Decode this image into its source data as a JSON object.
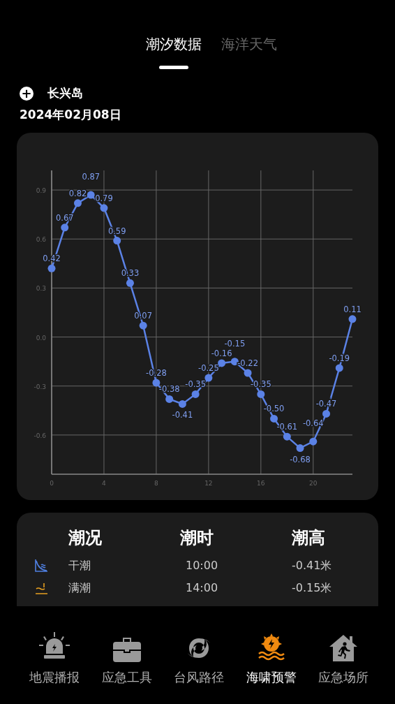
{
  "tabs": [
    {
      "label": "潮汐数据",
      "selected": true
    },
    {
      "label": "海洋天气",
      "selected": false
    }
  ],
  "location": {
    "add_icon": "+",
    "name": "长兴岛",
    "date": "2024年02月08日"
  },
  "chart": {
    "chart_data": {
      "type": "line",
      "x": [
        0,
        1,
        2,
        3,
        4,
        5,
        6,
        7,
        8,
        9,
        10,
        11,
        12,
        13,
        14,
        15,
        16,
        17,
        18,
        19,
        20,
        21,
        22,
        23
      ],
      "series": [
        {
          "color": "#5b82e6",
          "marker": "circle",
          "values": [
            0.42,
            0.67,
            0.82,
            0.87,
            0.79,
            0.59,
            0.33,
            0.07,
            -0.28,
            -0.38,
            -0.41,
            -0.35,
            -0.25,
            -0.16,
            -0.15,
            -0.22,
            -0.35,
            -0.5,
            -0.61,
            -0.68,
            -0.64,
            -0.47,
            -0.19,
            0.11
          ]
        }
      ],
      "xlim": [
        0,
        23
      ],
      "ylim": [
        -0.84,
        1.02
      ],
      "xticks": [
        0,
        4,
        8,
        12,
        16,
        20
      ],
      "yticks": [
        {
          "value": -0.6,
          "label": "-0.6"
        },
        {
          "value": -0.3,
          "label": "-0.3"
        },
        {
          "value": 0,
          "label": "0.0"
        },
        {
          "value": 0.3,
          "label": "0.3"
        },
        {
          "value": 0.6,
          "label": "0.6"
        },
        {
          "value": 0.9,
          "label": "0.9"
        }
      ],
      "grid": true,
      "value_labels": [
        "0.42",
        "0.67",
        "0.82",
        "0.87",
        "0.79",
        "0.59",
        "0.33",
        "0.07",
        "-0.28",
        "-0.38",
        "-0.41",
        "-0.35",
        "-0.25",
        "-0.16",
        "-0.15",
        "-0.22",
        "-0.35",
        "-0.50",
        "-0.61",
        "-0.68",
        "-0.64",
        "-0.47",
        "-0.19",
        "0.11"
      ]
    }
  },
  "table": {
    "columns": [
      "潮况",
      "潮时",
      "潮高"
    ],
    "rows": [
      {
        "kind": "low",
        "state": "干潮",
        "time": "10:00",
        "height": "-0.41米"
      },
      {
        "kind": "high",
        "state": "满潮",
        "time": "14:00",
        "height": "-0.15米"
      }
    ]
  },
  "nav": [
    {
      "kind": "siren",
      "label": "地震播报",
      "selected": false
    },
    {
      "kind": "toolbox",
      "label": "应急工具",
      "selected": false
    },
    {
      "kind": "cyclone",
      "label": "台风路径",
      "selected": false
    },
    {
      "kind": "tsunami",
      "label": "海啸预警",
      "selected": true
    },
    {
      "kind": "shelter",
      "label": "应急场所",
      "selected": false
    }
  ]
}
